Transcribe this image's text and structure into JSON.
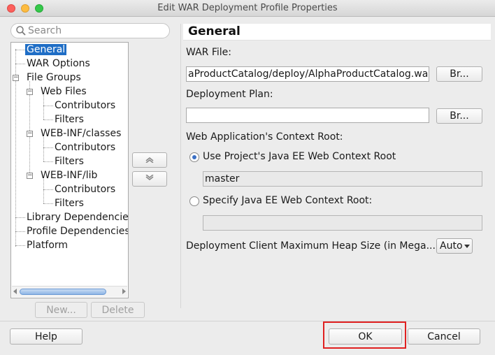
{
  "window": {
    "title": "Edit WAR Deployment Profile Properties"
  },
  "search": {
    "placeholder": "Search"
  },
  "tree": {
    "items": [
      {
        "label": "General"
      },
      {
        "label": "WAR Options"
      },
      {
        "label": "File Groups"
      },
      {
        "label": "Web Files"
      },
      {
        "label": "Contributors"
      },
      {
        "label": "Filters"
      },
      {
        "label": "WEB-INF/classes"
      },
      {
        "label": "Contributors"
      },
      {
        "label": "Filters"
      },
      {
        "label": "WEB-INF/lib"
      },
      {
        "label": "Contributors"
      },
      {
        "label": "Filters"
      },
      {
        "label": "Library Dependencies"
      },
      {
        "label": "Profile Dependencies"
      },
      {
        "label": "Platform"
      }
    ],
    "selected": "General"
  },
  "left_buttons": {
    "new": "New...",
    "delete": "Delete"
  },
  "general": {
    "title": "General",
    "war_file_label": "WAR File:",
    "war_file_value": "aProductCatalog/deploy/AlphaProductCatalog.wa",
    "browse_label": "Br...",
    "deployment_plan_label": "Deployment Plan:",
    "deployment_plan_value": "",
    "context_root_label": "Web Application's Context Root:",
    "radio_use_project": "Use Project's Java EE Web Context Root",
    "context_root_value": "master",
    "radio_specify": "Specify Java EE Web Context Root:",
    "specify_value": "",
    "heap_label": "Deployment Client Maximum Heap Size (in Mega...",
    "heap_value": "Auto"
  },
  "footer": {
    "help": "Help",
    "ok": "OK",
    "cancel": "Cancel"
  },
  "colors": {
    "selection": "#1f6ec6",
    "highlight_border": "#e02020"
  }
}
